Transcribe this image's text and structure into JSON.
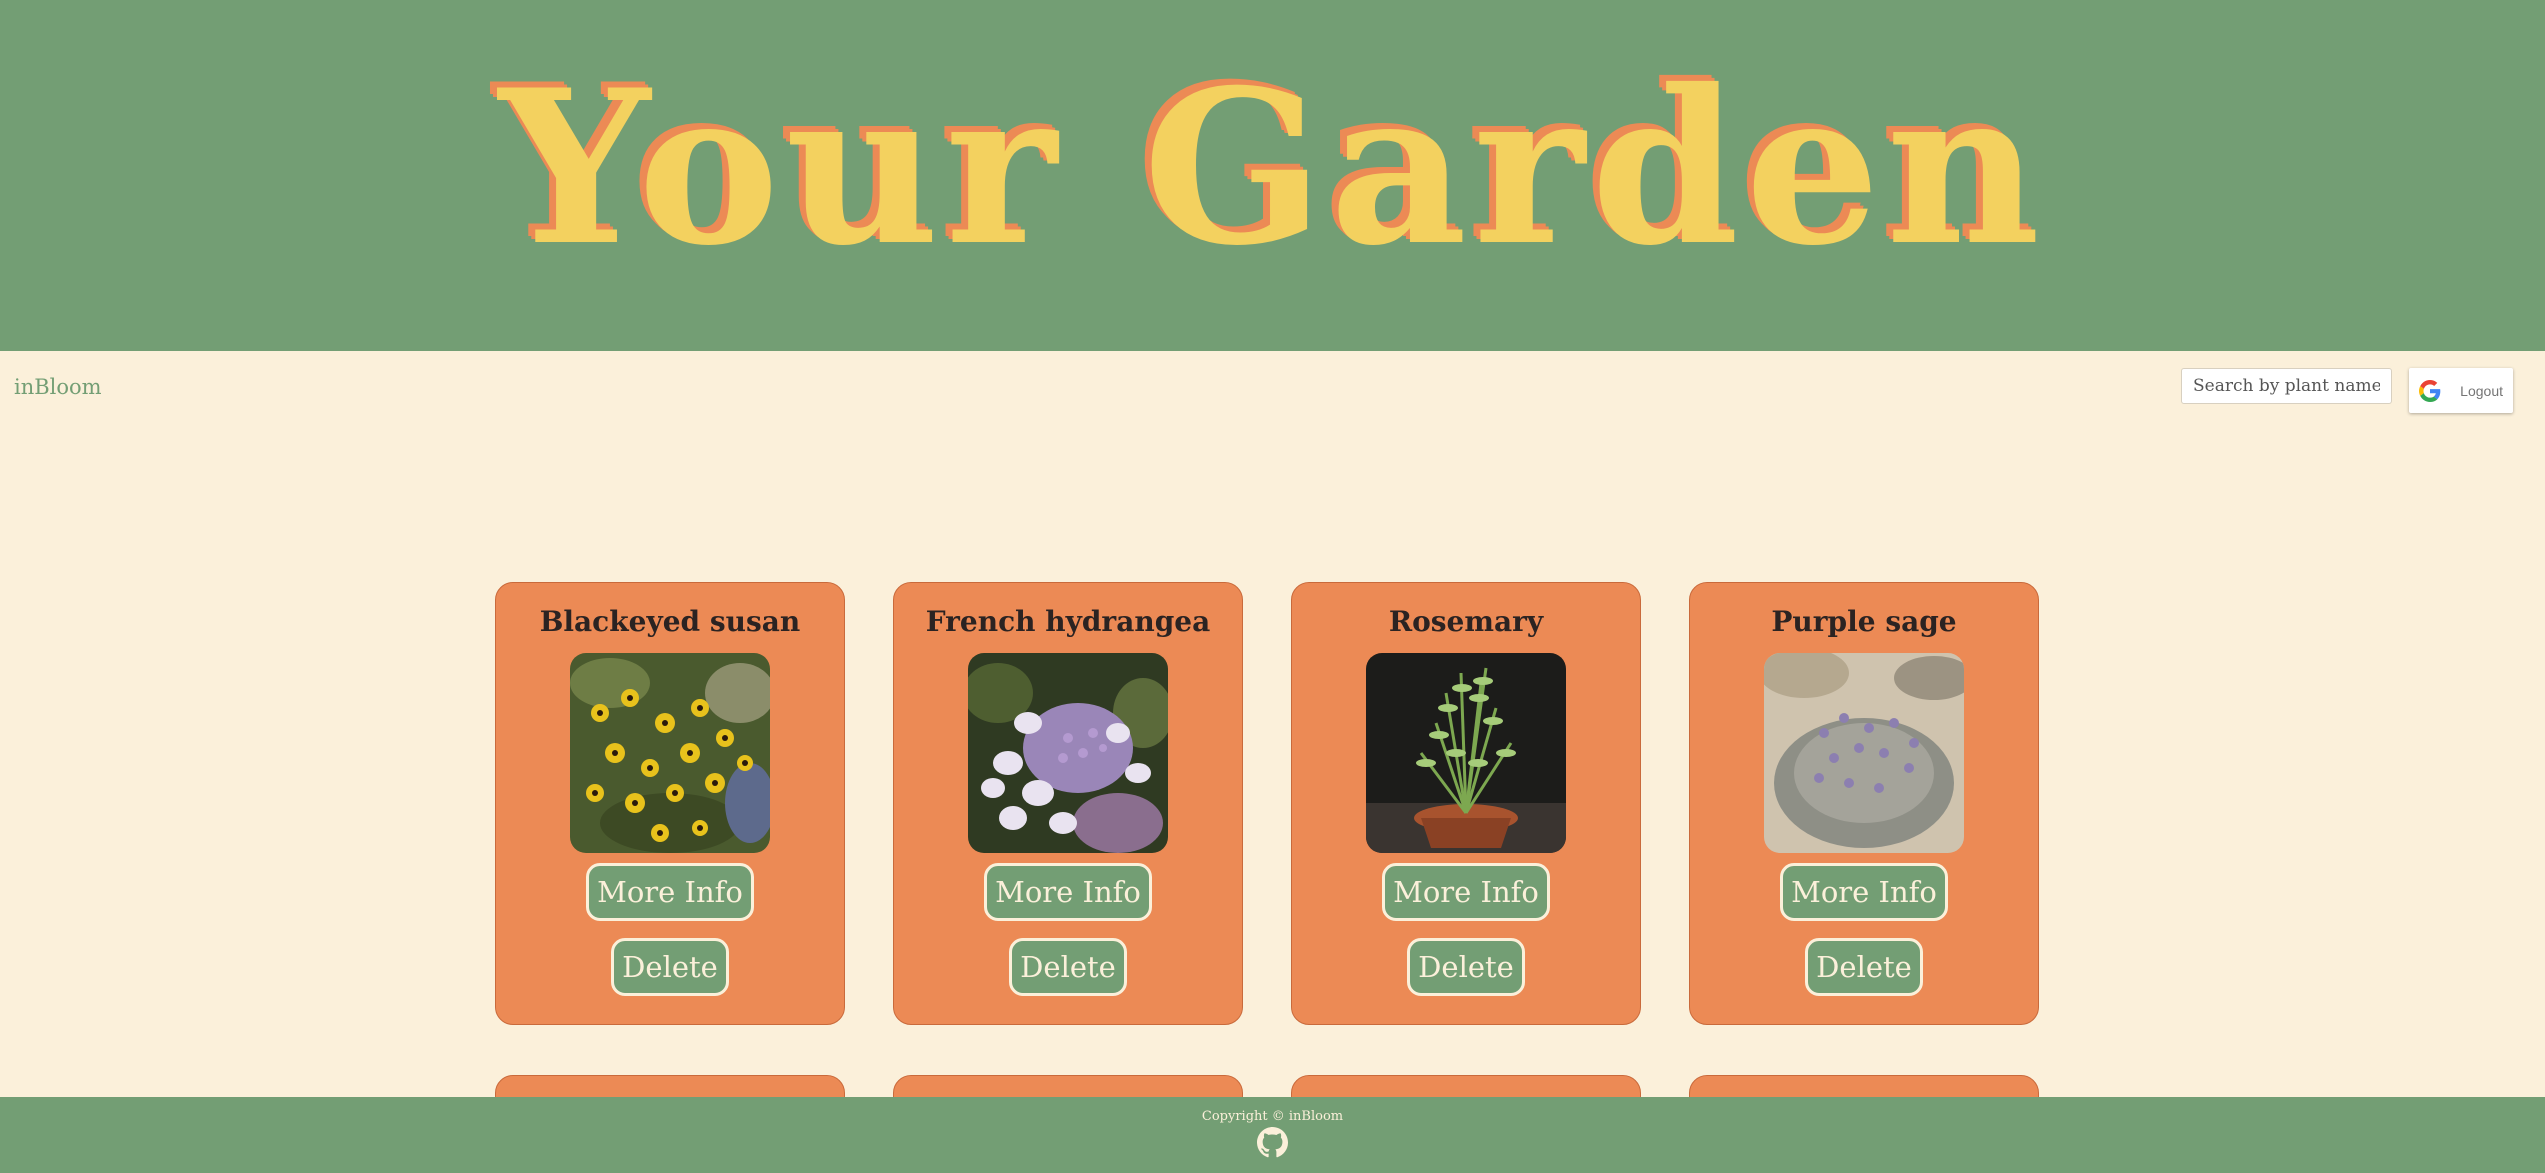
{
  "banner": {
    "title": "Your Garden"
  },
  "navbar": {
    "brand": "inBloom",
    "search_placeholder": "Search by plant name",
    "logout_label": "Logout",
    "logout_icon": "google-g-icon"
  },
  "plants": [
    {
      "name": "Blackeyed susan",
      "more_info_label": "More Info",
      "delete_label": "Delete"
    },
    {
      "name": "French hydrangea",
      "more_info_label": "More Info",
      "delete_label": "Delete"
    },
    {
      "name": "Rosemary",
      "more_info_label": "More Info",
      "delete_label": "Delete"
    },
    {
      "name": "Purple sage",
      "more_info_label": "More Info",
      "delete_label": "Delete"
    }
  ],
  "footer": {
    "copyright": "Copyright © inBloom",
    "icon": "github-icon"
  },
  "colors": {
    "banner_green": "#739e74",
    "background_cream": "#fbf0da",
    "title_yellow": "#f3d15f",
    "card_orange": "#ec8a55",
    "card_title": "#2b2322"
  }
}
